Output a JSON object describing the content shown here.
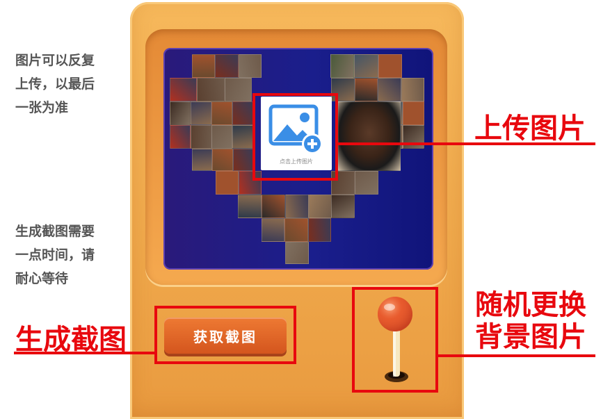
{
  "notes": {
    "left_top": [
      "图片可以反复",
      "上传，以最后",
      "一张为准"
    ],
    "left_bottom": [
      "生成截图需要",
      "一点时间，请",
      "耐心等待"
    ]
  },
  "upload": {
    "label": "点击上传图片",
    "callout": "上传图片"
  },
  "capture": {
    "button_label": "获取截图",
    "callout": "生成截图"
  },
  "joystick": {
    "callout_line1": "随机更换",
    "callout_line2": "背景图片"
  },
  "colors": {
    "accent_red": "#e8080e",
    "machine_orange": "#efa84b",
    "screen_blue": "#1a1e8c",
    "button_orange": "#e06a29",
    "icon_blue": "#3a8ee6"
  }
}
